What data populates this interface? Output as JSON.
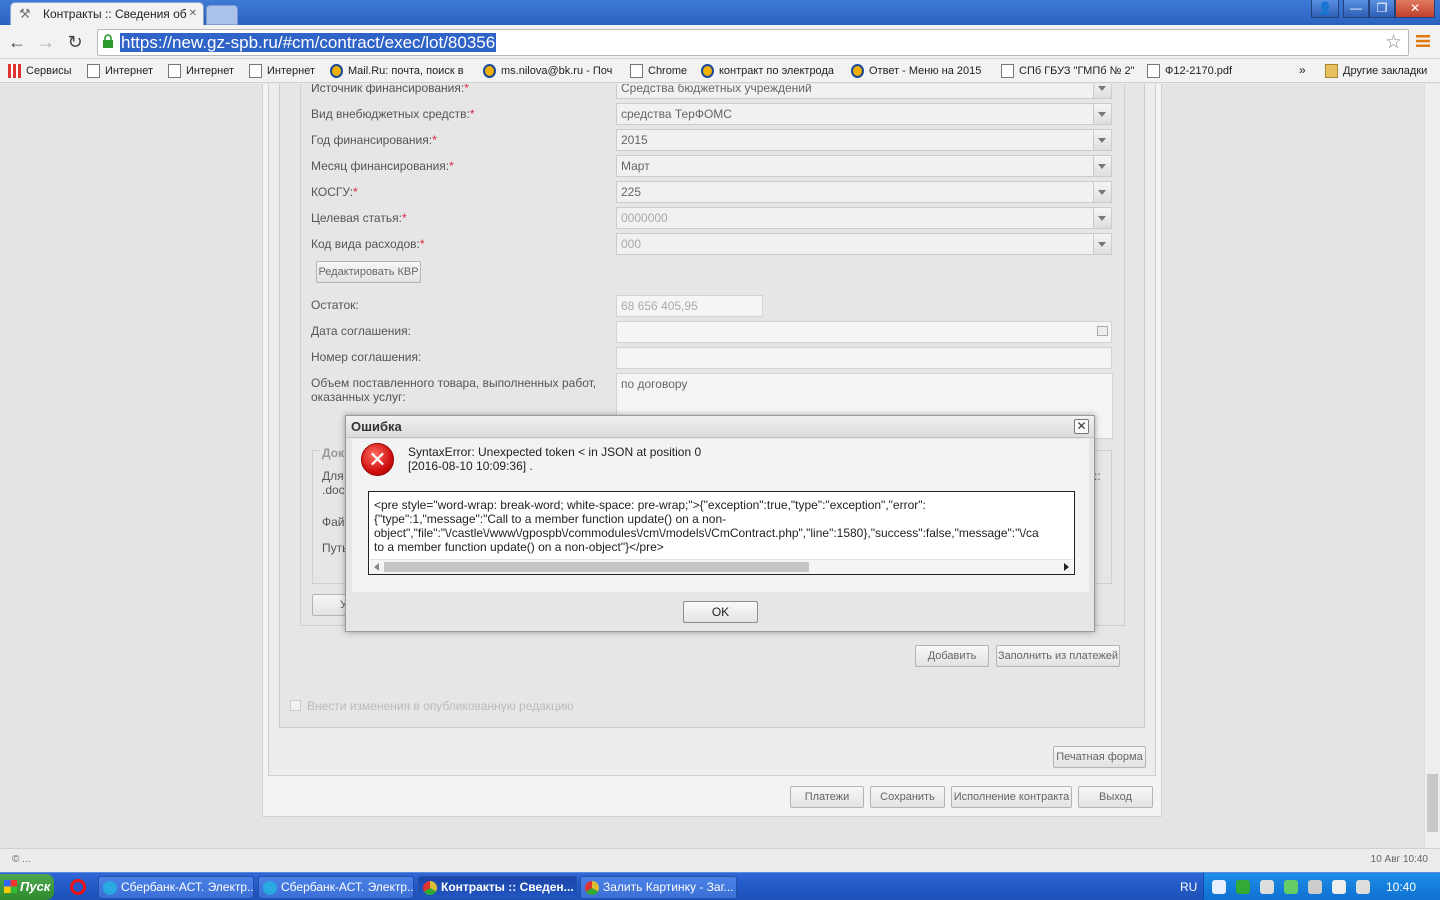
{
  "browser": {
    "tab_title": "Контракты :: Сведения об",
    "url": "https://new.gz-spb.ru/#cm/contract/exec/lot/80356",
    "window_buttons": {
      "user": "👤",
      "minimize": "—",
      "restore": "❐",
      "close": "✕"
    }
  },
  "bookmarks": [
    {
      "label": "Сервисы",
      "icon": "apps-icon"
    },
    {
      "label": "Интернет",
      "icon": "page-icon"
    },
    {
      "label": "Интернет",
      "icon": "page-icon"
    },
    {
      "label": "Интернет",
      "icon": "page-icon"
    },
    {
      "label": "Mail.Ru: почта, поиск в",
      "icon": "mail-icon"
    },
    {
      "label": "ms.nilova@bk.ru - Поч",
      "icon": "mail-icon"
    },
    {
      "label": "Chrome",
      "icon": "page-icon"
    },
    {
      "label": "контракт по электрода",
      "icon": "mail-icon"
    },
    {
      "label": "Ответ - Меню на 2015",
      "icon": "mail-icon"
    },
    {
      "label": "СПб ГБУЗ \"ГМПб № 2\"",
      "icon": "page-icon"
    },
    {
      "label": "Ф12-2170.pdf",
      "icon": "page-icon"
    }
  ],
  "bookmarks_more": "»",
  "bookmarks_other": "Другие закладки",
  "form": {
    "fields": [
      {
        "label": "Источник финансирования:",
        "value": "Средства бюджетных учреждений",
        "disabled": false
      },
      {
        "label": "Вид внебюджетных средств:",
        "value": "средства ТерФОМС",
        "disabled": false
      },
      {
        "label": "Год финансирования:",
        "value": "2015",
        "disabled": false
      },
      {
        "label": "Месяц финансирования:",
        "value": "Март",
        "disabled": false
      },
      {
        "label": "КОСГУ:",
        "value": "225",
        "disabled": false
      },
      {
        "label": "Целевая статья:",
        "value": "0000000",
        "disabled": true
      },
      {
        "label": "Код вида расходов:",
        "value": "000",
        "disabled": true
      }
    ],
    "required_mark": "*",
    "edit_kvr_button": "Редактировать КВР",
    "remainder_label": "Остаток:",
    "remainder_value": "68 656 405,95",
    "agreement_date_label": "Дата соглашения:",
    "agreement_number_label": "Номер соглашения:",
    "volume_label_line1": "Объем поставленного товара, выполненных работ,",
    "volume_label_line2": "оказанных услуг:",
    "volume_value": "по договору",
    "docs_partial": {
      "legend": "Док",
      "l1": "Для",
      "l2": ".doc",
      "l3": "Фай",
      "l4": "Путь",
      "right1": "::",
      "btn": "У"
    },
    "add_button": "Добавить",
    "fill_from_payments_button": "Заполнить из платежей",
    "publish_checkbox_label": "Внести изменения в опубликованную редакцию",
    "print_form_button": "Печатная форма",
    "footer_buttons": [
      "Платежи",
      "Сохранить",
      "Исполнение контракта",
      "Выход"
    ]
  },
  "dialog": {
    "title": "Ошибка",
    "message_line1": "SyntaxError: Unexpected token < in JSON at position 0",
    "message_line2": "[2016-08-10 10:09:36] .",
    "detail_lines": [
      "<pre style=\"word-wrap: break-word; white-space: pre-wrap;\">{\"exception\":true,\"type\":\"exception\",\"error\":",
      "{\"type\":1,\"message\":\"Call to a member function update() on a non-",
      "object\",\"file\":\"\\/castle\\/www\\/gpospb\\/commodules\\/cm\\/models\\/CmContract.php\",\"line\":1580},\"success\":false,\"message\":\"\\/ca",
      "to a member function update() on a non-object\"}</pre>"
    ],
    "ok_button": "OK",
    "close_glyph": "✕",
    "icon_glyph": "✕"
  },
  "statusbar": {
    "left": "© ...",
    "right": "10 Авг 10:40"
  },
  "taskbar": {
    "start": "Пуск",
    "items": [
      {
        "label": "Сбербанк-АСТ. Электр...",
        "active": false
      },
      {
        "label": "Сбербанк-АСТ. Электр...",
        "active": false
      },
      {
        "label": "Контракты :: Сведен...",
        "active": true
      },
      {
        "label": "Залить Картинку - Заг...",
        "active": false
      }
    ],
    "lang": "RU",
    "clock": "10:40"
  },
  "colors": {
    "url_highlight": "#2f63c7",
    "error_red": "#d01010",
    "taskbar_blue": "#245bc9",
    "required": "#d24"
  }
}
